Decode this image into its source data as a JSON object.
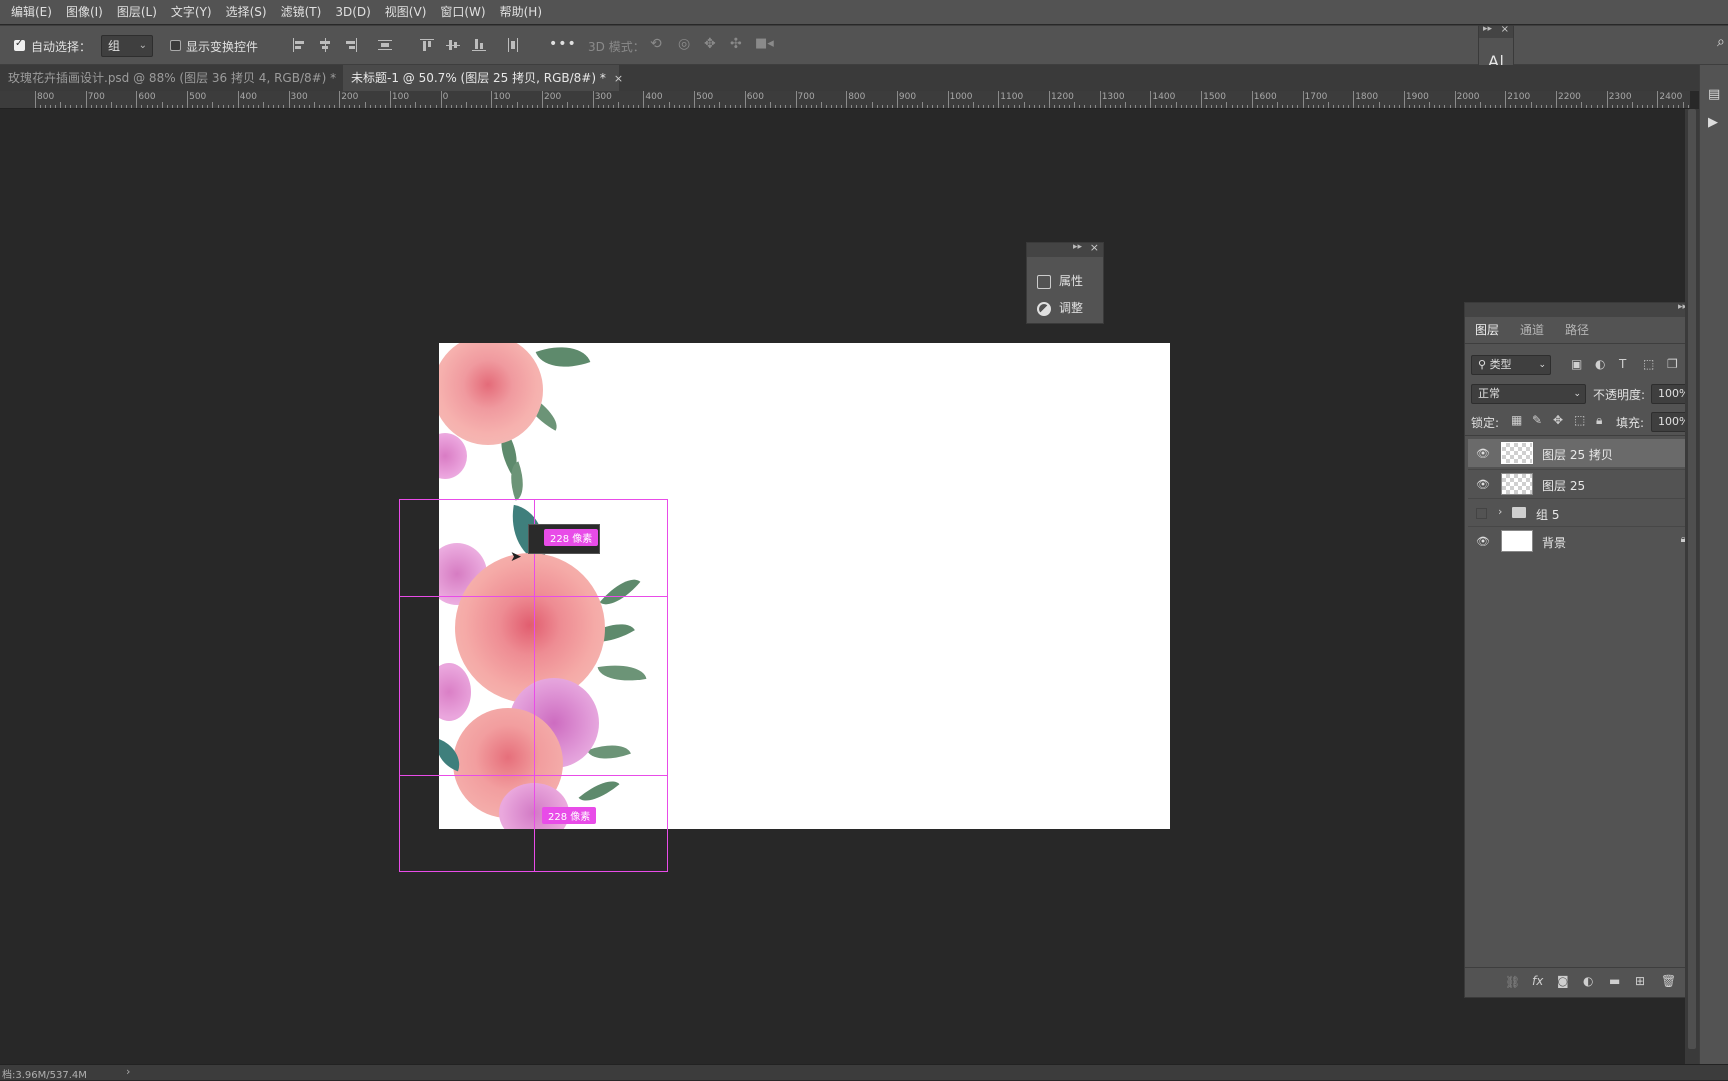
{
  "menu": [
    "编辑(E)",
    "图像(I)",
    "图层(L)",
    "文字(Y)",
    "选择(S)",
    "滤镜(T)",
    "3D(D)",
    "视图(V)",
    "窗口(W)",
    "帮助(H)"
  ],
  "options": {
    "auto_select_label": "自动选择：",
    "auto_select_value": "组",
    "show_transform_label": "显示变换控件",
    "mode_3d_label": "3D 模式："
  },
  "tabs": [
    {
      "label": "玫瑰花卉插画设计.psd @ 88% (图层 36 拷贝 4, RGB/8#) *",
      "close": "×"
    },
    {
      "label": "未标题-1 @ 50.7% (图层 25 拷贝, RGB/8#) *",
      "close": "×"
    }
  ],
  "ruler": [
    "800",
    "700",
    "600",
    "500",
    "400",
    "300",
    "200",
    "100",
    "0",
    "100",
    "200",
    "300",
    "400",
    "500",
    "600",
    "700",
    "800",
    "900",
    "1000",
    "1100",
    "1200",
    "1300",
    "1400",
    "1500",
    "1600",
    "1700",
    "1800",
    "1900",
    "2000",
    "2100",
    "2200",
    "2300",
    "2400"
  ],
  "canvas": {
    "measure_top": "228 像素",
    "measure_bottom": "228 像素"
  },
  "props_panel": {
    "properties": "属性",
    "adjustments": "调整"
  },
  "layers_panel": {
    "tabs": [
      "图层",
      "通道",
      "路径"
    ],
    "filter_kind": "类型",
    "blend_mode": "正常",
    "opacity_label": "不透明度:",
    "opacity_value": "100%",
    "lock_label": "锁定:",
    "fill_label": "填充:",
    "fill_value": "100%",
    "layers": [
      {
        "name": "图层 25 拷贝",
        "visible": true,
        "selected": true
      },
      {
        "name": "图层 25",
        "visible": true,
        "selected": false
      },
      {
        "name": "组 5",
        "visible": false,
        "selected": false
      },
      {
        "name": "背景",
        "visible": true,
        "selected": false
      }
    ]
  },
  "status": {
    "doc_size": "档:3.96M/537.4M"
  },
  "colors": {
    "guide": "#e84ce8",
    "panel_bg": "#535353",
    "canvas_bg": "#282828"
  }
}
